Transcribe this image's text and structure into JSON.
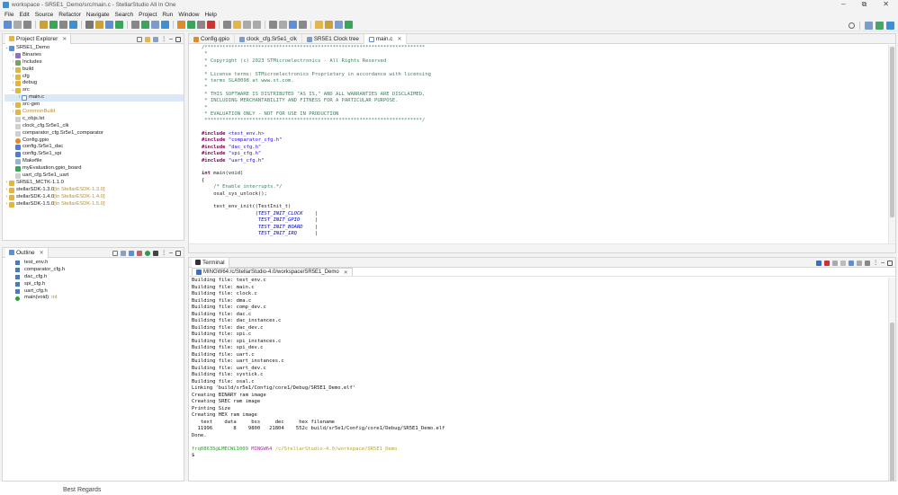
{
  "window": {
    "title": "workspace - SR5E1_Demo/src/main.c - StellarStudio All In One",
    "controls": [
      "–",
      "⧉",
      "✕"
    ]
  },
  "menu": [
    "File",
    "Edit",
    "Source",
    "Refactor",
    "Navigate",
    "Search",
    "Project",
    "Run",
    "Window",
    "Help"
  ],
  "project_explorer": {
    "title": "Project Explorer",
    "tree": [
      {
        "label": "SR5E1_Demo",
        "icon": "project-icon",
        "twisty": "v",
        "indent": 0,
        "cls": "proj"
      },
      {
        "label": "Binaries",
        "icon": "binaries-icon",
        "twisty": ">",
        "indent": 1,
        "cls": "bin"
      },
      {
        "label": "Includes",
        "icon": "includes-icon",
        "twisty": ">",
        "indent": 1,
        "cls": "inc"
      },
      {
        "label": "build",
        "icon": "folder-icon",
        "twisty": ">",
        "indent": 1,
        "cls": "folder"
      },
      {
        "label": "cfg",
        "icon": "folder-icon",
        "twisty": ">",
        "indent": 1,
        "cls": "folder"
      },
      {
        "label": "debug",
        "icon": "folder-icon",
        "twisty": ">",
        "indent": 1,
        "cls": "folder"
      },
      {
        "label": "src",
        "icon": "folder-icon",
        "twisty": "v",
        "indent": 1,
        "cls": "folder"
      },
      {
        "label": "main.c",
        "icon": "c-file-icon",
        "twisty": ">",
        "indent": 2,
        "cls": "cfile",
        "selected": true
      },
      {
        "label": "src-gen",
        "icon": "folder-icon",
        "twisty": ">",
        "indent": 1,
        "cls": "folder"
      },
      {
        "label": "CommonBuild",
        "icon": "folder-icon",
        "twisty": ">",
        "indent": 1,
        "cls": "folder",
        "muted": true
      },
      {
        "label": "c_objs.lst",
        "icon": "file-icon",
        "twisty": "",
        "indent": 1,
        "cls": "file"
      },
      {
        "label": "clock_cfg.Sr5e1_clk",
        "icon": "file-icon",
        "twisty": "",
        "indent": 1,
        "cls": "file"
      },
      {
        "label": "comparator_cfg.Sr5e1_comparator",
        "icon": "file-icon",
        "twisty": "",
        "indent": 1,
        "cls": "file"
      },
      {
        "label": "Config.gpio",
        "icon": "gpio-icon",
        "twisty": "",
        "indent": 1,
        "cls": "gpio"
      },
      {
        "label": "config.Sr5e1_dac",
        "icon": "file-icon",
        "twisty": "",
        "indent": 1,
        "cls": "uart"
      },
      {
        "label": "config.Sr5e1_spi",
        "icon": "file-icon",
        "twisty": "",
        "indent": 1,
        "cls": "uart"
      },
      {
        "label": "Makefile",
        "icon": "makefile-icon",
        "twisty": "",
        "indent": 1,
        "cls": "make"
      },
      {
        "label": "myEvaluation.gpio_board",
        "icon": "board-icon",
        "twisty": "",
        "indent": 1,
        "cls": "board"
      },
      {
        "label": "uart_cfg.Sr5e1_uart",
        "icon": "file-icon",
        "twisty": "",
        "indent": 1,
        "cls": "file"
      },
      {
        "label": "SR5E1_MCTK-1.1.0",
        "icon": "project-icon",
        "twisty": ">",
        "indent": 0,
        "cls": "folder"
      },
      {
        "label": "stellarSDK-1.3.0",
        "suffix": " [in StellarESDK-1.3.0]",
        "icon": "project-icon",
        "twisty": ">",
        "indent": 0,
        "cls": "folder"
      },
      {
        "label": "stellarSDK-1.4.0",
        "suffix": " [in StellarESDK-1.4.0]",
        "icon": "project-icon",
        "twisty": ">",
        "indent": 0,
        "cls": "folder"
      },
      {
        "label": "stellarSDK-1.5.0",
        "suffix": " [in StellarESDK-1.5.0]",
        "icon": "project-icon",
        "twisty": ">",
        "indent": 0,
        "cls": "folder"
      }
    ]
  },
  "outline": {
    "title": "Outline",
    "items": [
      {
        "label": "test_env.h",
        "kind": "h"
      },
      {
        "label": "comparator_cfg.h",
        "kind": "h"
      },
      {
        "label": "dac_cfg.h",
        "kind": "h"
      },
      {
        "label": "spi_cfg.h",
        "kind": "h"
      },
      {
        "label": "uart_cfg.h",
        "kind": "h"
      },
      {
        "label": "main(void)",
        "ret": " : int",
        "kind": "fn"
      }
    ]
  },
  "editor": {
    "tabs": [
      {
        "label": "Config.gpio",
        "active": false
      },
      {
        "label": "clock_cfg.Sr5e1_clk",
        "active": false
      },
      {
        "label": "SR5E1 Clock tree",
        "active": false
      },
      {
        "label": "main.c",
        "active": true,
        "closable": true
      }
    ],
    "lines": [
      {
        "t": "/**************************************************************************",
        "c": "cm"
      },
      {
        "t": " *",
        "c": "cm"
      },
      {
        "t": " * Copyright (c) 2023 STMicroelectronics - All Rights Reserved",
        "c": "cm"
      },
      {
        "t": " *",
        "c": "cm"
      },
      {
        "t": " * License terms: STMicroelectronics Proprietary in accordance with licensing",
        "c": "cm"
      },
      {
        "t": " * terms SLA0098 at www.st.com.",
        "c": "cm"
      },
      {
        "t": " *",
        "c": "cm"
      },
      {
        "t": " * THIS SOFTWARE IS DISTRIBUTED \"AS IS,\" AND ALL WARRANTIES ARE DISCLAIMED,",
        "c": "cm"
      },
      {
        "t": " * INCLUDING MERCHANTABILITY AND FITNESS FOR A PARTICULAR PURPOSE.",
        "c": "cm"
      },
      {
        "t": " *",
        "c": "cm"
      },
      {
        "t": " * EVALUATION ONLY - NOT FOR USE IN PRODUCTION",
        "c": "cm"
      },
      {
        "t": " *************************************************************************/",
        "c": "cm"
      },
      {
        "t": "",
        "c": ""
      },
      {
        "kw": "#include ",
        "st": "<test_env.h>"
      },
      {
        "kw": "#include ",
        "st": "\"comparator_cfg.h\""
      },
      {
        "kw": "#include ",
        "st": "\"dac_cfg.h\""
      },
      {
        "kw": "#include ",
        "st": "\"spi_cfg.h\""
      },
      {
        "kw": "#include ",
        "st": "\"uart_cfg.h\""
      },
      {
        "t": "",
        "c": ""
      },
      {
        "kw": "int ",
        "t": "main(void)"
      },
      {
        "t": "{",
        "c": ""
      },
      {
        "t": "    /* Enable interrupts.*/",
        "c": "cm"
      },
      {
        "t": "    osal_sys_unlock();",
        "c": ""
      },
      {
        "t": "",
        "c": ""
      },
      {
        "t": "    test_env_init((TestInit_t)",
        "c": ""
      },
      {
        "pre": "                  (",
        "it": "TEST_INIT_CLOCK",
        "post": "    |"
      },
      {
        "pre": "                   ",
        "it": "TEST_INIT_GPIO",
        "post": "     |"
      },
      {
        "pre": "                   ",
        "it": "TEST_INIT_BOARD",
        "post": "    |"
      },
      {
        "pre": "                   ",
        "it": "TEST_INIT_IRQ",
        "post": "      |"
      }
    ]
  },
  "terminal": {
    "title": "Terminal",
    "session": "MINGW64:/c/StellarStudio-4.0/workspace/SR5E1_Demo",
    "lines": [
      "Building file: test_env.c",
      "Building file: main.c",
      "Building file: clock.c",
      "Building file: dma.c",
      "Building file: comp_dev.c",
      "Building file: dac.c",
      "Building file: dac_instances.c",
      "Building file: dac_dev.c",
      "Building file: spi.c",
      "Building file: spi_instances.c",
      "Building file: spi_dev.c",
      "Building file: uart.c",
      "Building file: uart_instances.c",
      "Building file: uart_dev.c",
      "Building file: systick.c",
      "Building file: osal.c",
      "Linking 'build/sr5e1/Config/core1/Debug/SR5E1_Demo.elf'",
      "Creating BINARY ram image",
      "Creating SREC ram image",
      "Printing Size",
      "Creating HEX ram image",
      "   text    data     bss     dec     hex filename",
      "  11996       8    9800   21804    552c build/sr5e1/Config/core1/Debug/SR5E1_Demo.elf",
      "Done.",
      ""
    ],
    "prompt_user": "frq08635@LMECWL1009",
    "prompt_env": " MINGW64",
    "prompt_path": " /c/StellarStudio-4.0/workspace/SR5E1_Demo",
    "prompt_symbol": "$"
  },
  "footer_text": "Best Regards"
}
